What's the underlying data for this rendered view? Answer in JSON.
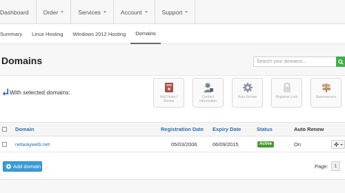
{
  "topnav": {
    "items": [
      {
        "label": "Dashboard",
        "caret": false
      },
      {
        "label": "Order",
        "caret": true
      },
      {
        "label": "Services",
        "caret": true
      },
      {
        "label": "Account",
        "caret": true
      },
      {
        "label": "Support",
        "caret": true
      }
    ]
  },
  "subnav": {
    "items": [
      {
        "label": "Summary",
        "active": false
      },
      {
        "label": "Linux Hosting",
        "active": false
      },
      {
        "label": "Windows 2012 Hosting",
        "active": false
      },
      {
        "label": "Domains",
        "active": true
      }
    ]
  },
  "page": {
    "title": "Domains",
    "search_placeholder": "Search your domains..."
  },
  "bulk": {
    "label": "With selected domains:",
    "actions": [
      {
        "label": "Add Years / Renew",
        "icon": "book-icon"
      },
      {
        "label": "Contact Information",
        "icon": "user-contact-icon"
      },
      {
        "label": "Auto Renew",
        "icon": "gear-icon"
      },
      {
        "label": "Registrar Lock",
        "icon": "lock-icon"
      },
      {
        "label": "Nameservers",
        "icon": "signpost-icon"
      }
    ]
  },
  "table": {
    "headers": {
      "domain": "Domain",
      "registration_date": "Registration Date",
      "expiry_date": "Expiry Date",
      "status": "Status",
      "auto_renew": "Auto Renew"
    },
    "rows": [
      {
        "domain": "netwayweb.net",
        "registration_date": "05/03/2006",
        "expiry_date": "06/09/2015",
        "status": "Active",
        "auto_renew": "On"
      }
    ]
  },
  "footer": {
    "add_label": "Add domain",
    "page_label": "Page:",
    "page_number": "1"
  },
  "colors": {
    "link": "#2a6fb0",
    "active_badge": "#4a9a2e",
    "primary_button": "#3a9bd8",
    "search_button": "#3fae49"
  }
}
